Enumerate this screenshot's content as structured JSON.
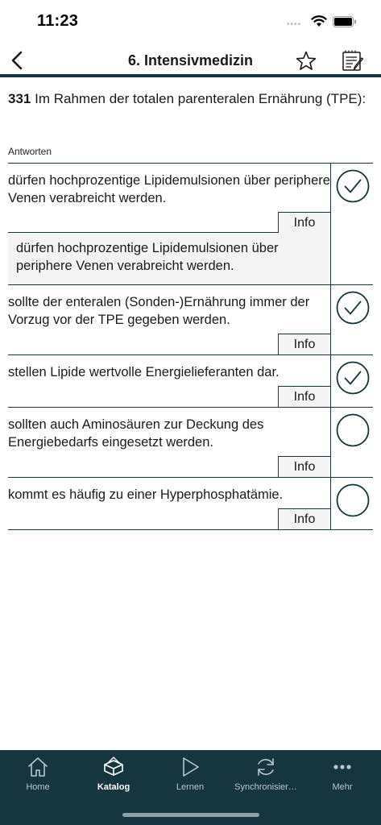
{
  "status": {
    "time": "11:23",
    "signal": "••••"
  },
  "nav": {
    "title": "6. Intensivmedizin"
  },
  "question": {
    "number": "331",
    "text": "Im Rahmen der totalen parenteralen Ernährung (TPE):"
  },
  "answers_label": "Antworten",
  "info_label": "Info",
  "answers": [
    {
      "text": "dürfen hochprozentige Lipidemulsionen über periphere Venen verabreicht werden.",
      "checked": true,
      "info_text": "dürfen hochprozentige Lipidemulsionen über periphere Venen verabreicht werden."
    },
    {
      "text": "sollte der enteralen (Sonden-)Ernährung immer der Vorzug vor der TPE gegeben werden.",
      "checked": true
    },
    {
      "text": "stellen Lipide wertvolle Energielieferanten dar.",
      "checked": true
    },
    {
      "text": "sollten auch Aminosäuren zur Deckung des Energiebedarfs eingesetzt werden.",
      "checked": false
    },
    {
      "text": "kommt es häufig zu einer Hyperphosphatämie.",
      "checked": false
    }
  ],
  "tabs": [
    {
      "label": "Home",
      "icon": "home-icon",
      "active": false
    },
    {
      "label": "Katalog",
      "icon": "catalog-icon",
      "active": true
    },
    {
      "label": "Lernen",
      "icon": "play-icon",
      "active": false
    },
    {
      "label": "Synchronisier…",
      "icon": "sync-icon",
      "active": false
    },
    {
      "label": "Mehr",
      "icon": "more-icon",
      "active": false
    }
  ],
  "colors": {
    "navy": "#16363f",
    "info_bg": "#f4f4f4",
    "tab_inactive": "#b9c6cb"
  }
}
